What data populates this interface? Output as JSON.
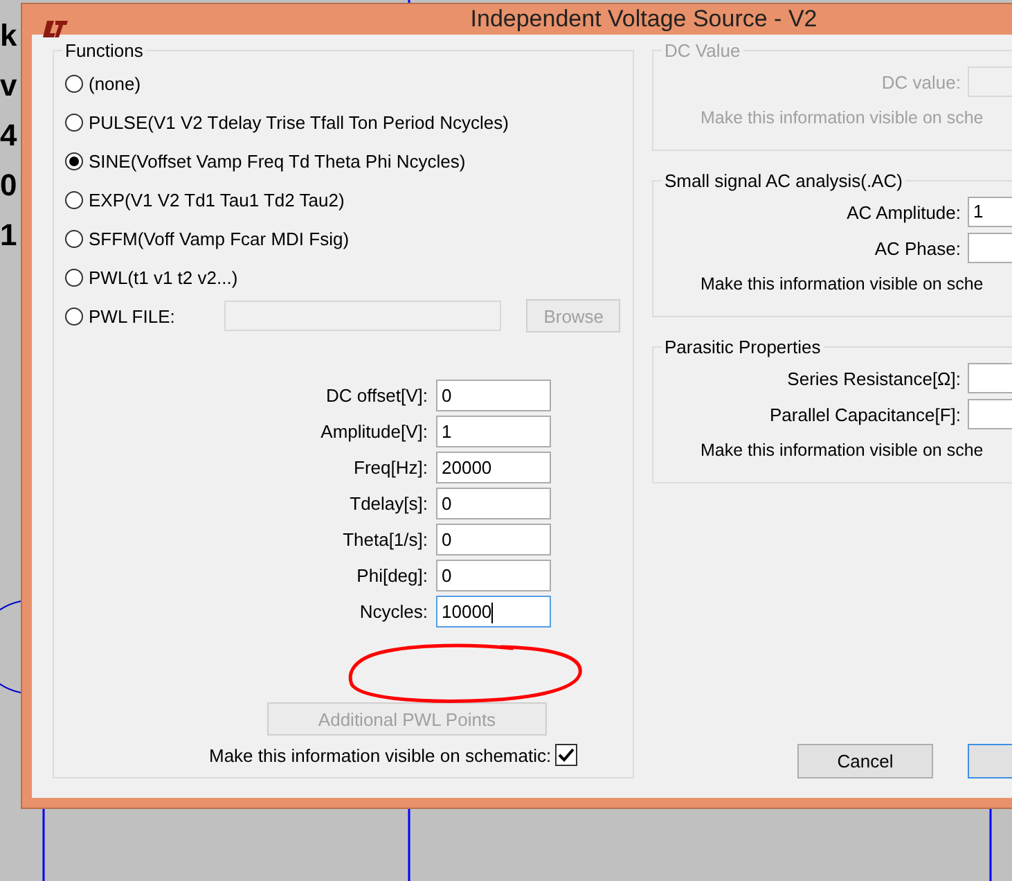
{
  "background": {
    "labels": [
      "k",
      "v",
      "4",
      "0",
      "1"
    ]
  },
  "window": {
    "title": "Independent Voltage Source - V2"
  },
  "functions": {
    "title": "Functions",
    "options": [
      {
        "label": "(none)",
        "selected": false
      },
      {
        "label": "PULSE(V1 V2 Tdelay Trise Tfall Ton Period Ncycles)",
        "selected": false
      },
      {
        "label": "SINE(Voffset Vamp Freq Td Theta Phi Ncycles)",
        "selected": true
      },
      {
        "label": "EXP(V1 V2 Td1 Tau1 Td2 Tau2)",
        "selected": false
      },
      {
        "label": "SFFM(Voff Vamp Fcar MDI Fsig)",
        "selected": false
      },
      {
        "label": "PWL(t1 v1 t2 v2...)",
        "selected": false
      },
      {
        "label": "PWL FILE:",
        "selected": false
      }
    ],
    "browse_button": {
      "label": "Browse",
      "disabled": true
    },
    "parameters": [
      {
        "label": "DC offset[V]:",
        "value": "0",
        "focused": false
      },
      {
        "label": "Amplitude[V]:",
        "value": "1",
        "focused": false
      },
      {
        "label": "Freq[Hz]:",
        "value": "20000",
        "focused": false
      },
      {
        "label": "Tdelay[s]:",
        "value": "0",
        "focused": false
      },
      {
        "label": "Theta[1/s]:",
        "value": "0",
        "focused": false
      },
      {
        "label": "Phi[deg]:",
        "value": "0",
        "focused": false
      },
      {
        "label": "Ncycles:",
        "value": "10000",
        "focused": true
      }
    ],
    "additional_button": {
      "label": "Additional PWL Points",
      "disabled": true
    },
    "visible_on_schematic": {
      "label": "Make this information visible on schematic:",
      "checked": true
    }
  },
  "dc_value": {
    "title": "DC Value",
    "disabled": true,
    "fields": [
      {
        "label": "DC value:"
      }
    ],
    "visible_label": "Make this information visible on sche"
  },
  "ac_analysis": {
    "title": "Small signal AC analysis(.AC)",
    "disabled": false,
    "fields": [
      {
        "label": "AC Amplitude:",
        "value": "1"
      },
      {
        "label": "AC Phase:"
      }
    ],
    "visible_label": "Make this information visible on sche"
  },
  "parasitic": {
    "title": "Parasitic Properties",
    "disabled": false,
    "fields": [
      {
        "label": "Series Resistance[Ω]:"
      },
      {
        "label": "Parallel Capacitance[F]:"
      }
    ],
    "visible_label": "Make this information visible on sche"
  },
  "buttons": [
    {
      "label": "Cancel",
      "default": false
    },
    {
      "default": true
    }
  ]
}
